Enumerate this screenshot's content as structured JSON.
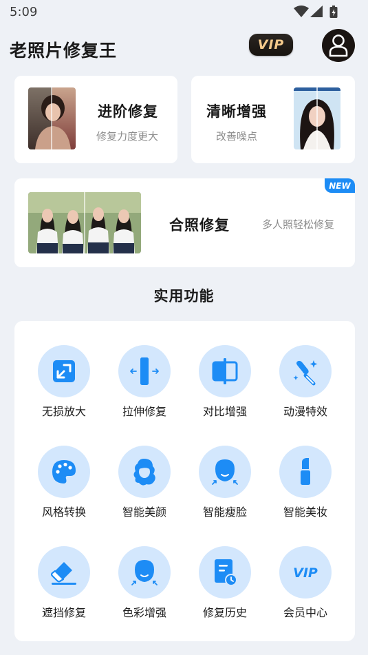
{
  "status_bar": {
    "time": "5:09"
  },
  "header": {
    "title": "老照片修复王",
    "vip_label": "VIP"
  },
  "cards": {
    "advanced": {
      "title": "进阶修复",
      "subtitle": "修复力度更大"
    },
    "clarity": {
      "title": "清晰增强",
      "subtitle": "改善噪点"
    },
    "group": {
      "title": "合照修复",
      "subtitle": "多人照轻松修复",
      "badge": "NEW"
    }
  },
  "section": {
    "title": "实用功能"
  },
  "tools": [
    {
      "label": "无损放大",
      "icon": "enlarge-icon"
    },
    {
      "label": "拉伸修复",
      "icon": "stretch-icon"
    },
    {
      "label": "对比增强",
      "icon": "contrast-icon"
    },
    {
      "label": "动漫特效",
      "icon": "magic-wand-icon"
    },
    {
      "label": "风格转换",
      "icon": "palette-icon"
    },
    {
      "label": "智能美颜",
      "icon": "hair-beauty-icon"
    },
    {
      "label": "智能瘦脸",
      "icon": "slim-face-icon"
    },
    {
      "label": "智能美妆",
      "icon": "lipstick-icon"
    },
    {
      "label": "遮挡修复",
      "icon": "eraser-icon"
    },
    {
      "label": "色彩增强",
      "icon": "color-face-icon"
    },
    {
      "label": "修复历史",
      "icon": "history-icon"
    },
    {
      "label": "会员中心",
      "icon": "vip-icon",
      "icon_text": "VIP"
    }
  ],
  "colors": {
    "accent": "#1d8cf5",
    "icon_bg": "#d3e7fd",
    "background": "#eef1f6"
  }
}
